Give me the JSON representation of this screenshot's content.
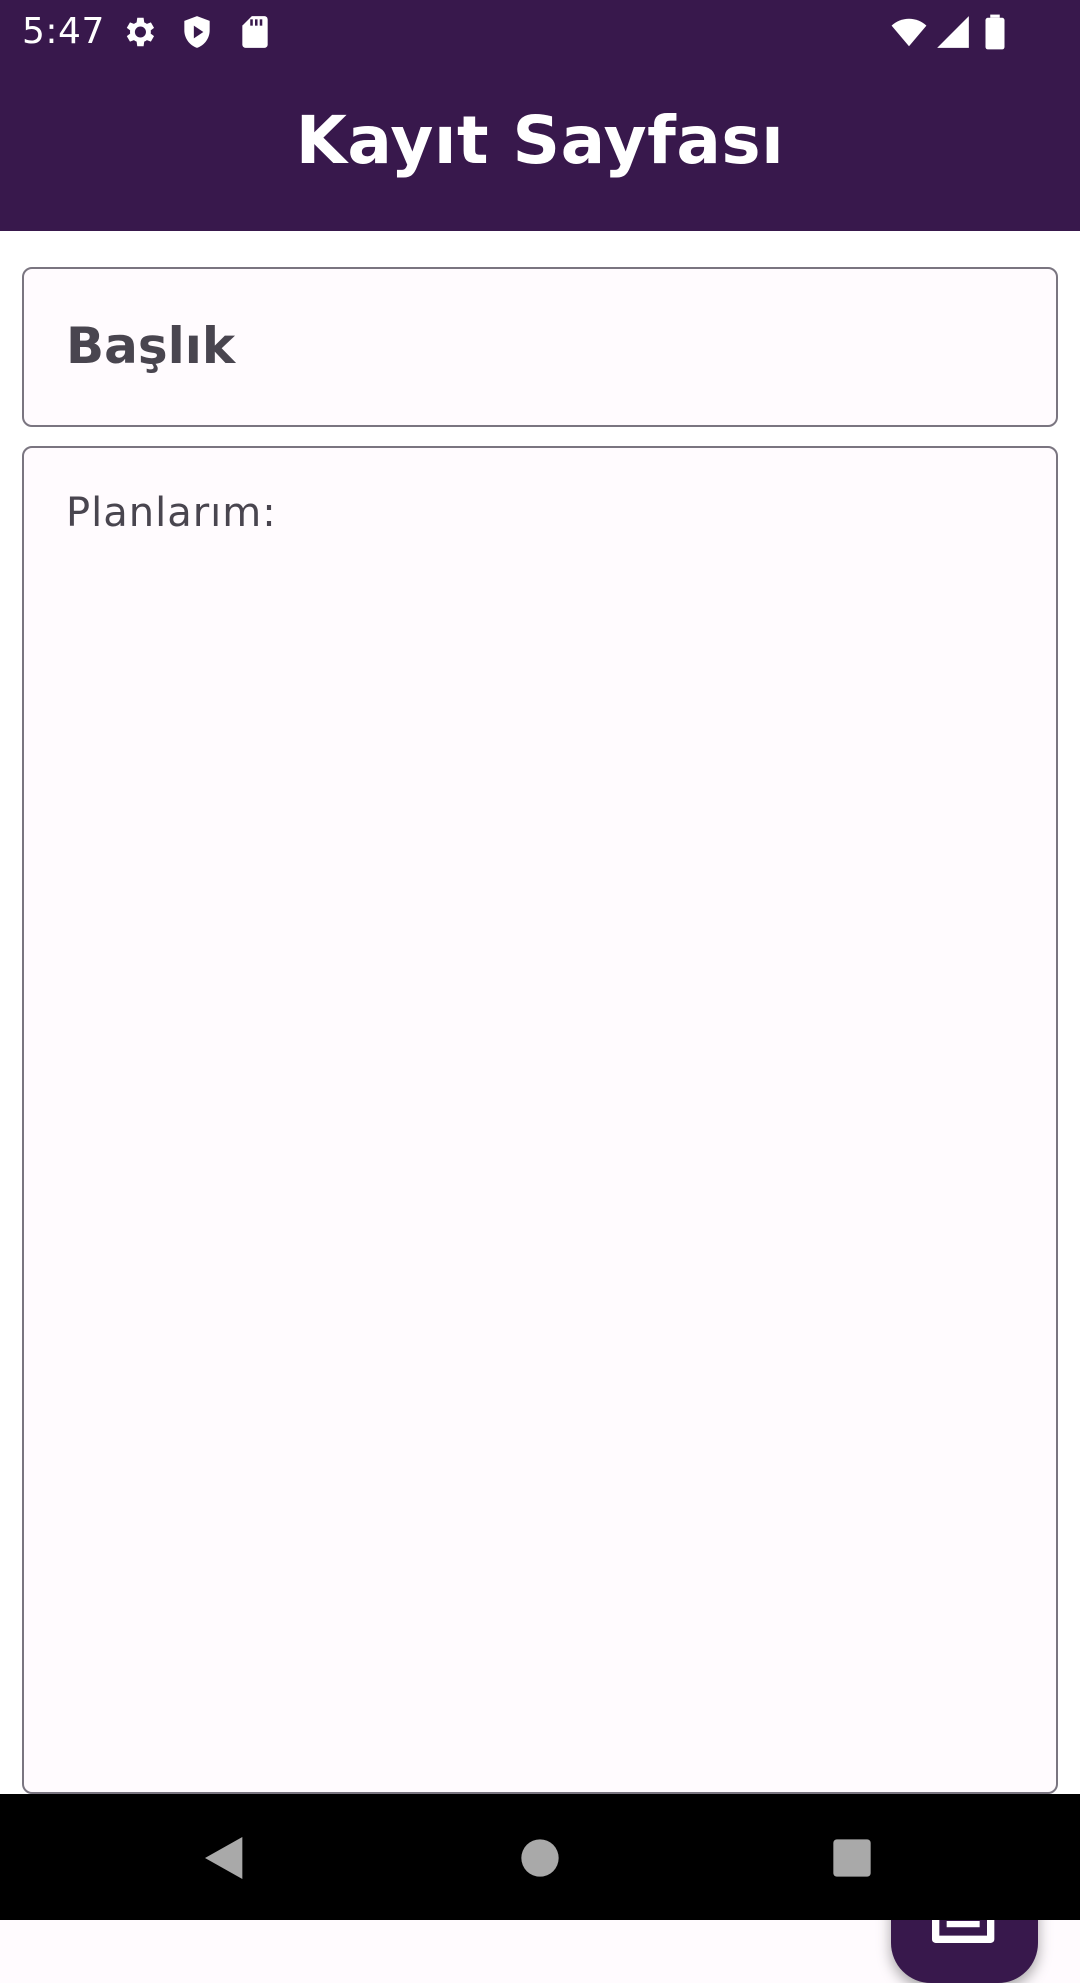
{
  "status_bar": {
    "time": "5:47",
    "icons_left": [
      "gear-icon",
      "shield-play-icon",
      "sd-card-icon"
    ],
    "icons_right": [
      "wifi-icon",
      "cell-signal-icon",
      "battery-icon"
    ]
  },
  "app_bar": {
    "title": "Kayıt Sayfası"
  },
  "form": {
    "title_field": {
      "placeholder": "Başlık",
      "value": ""
    },
    "plans_field": {
      "placeholder": "Planlarım:",
      "value": ""
    }
  },
  "fab": {
    "icon": "note-add-icon"
  },
  "nav_bar": {
    "buttons": [
      "back-icon",
      "home-icon",
      "recents-icon"
    ]
  },
  "colors": {
    "primary": "#38184c",
    "field_border": "#7a7580",
    "field_text": "#49454f",
    "surface": "#fffbfe"
  }
}
